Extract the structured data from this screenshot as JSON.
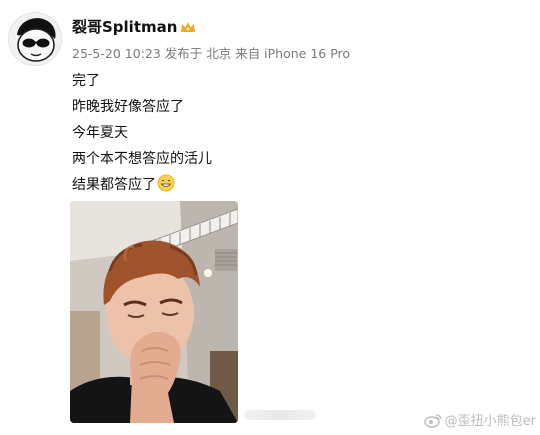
{
  "header": {
    "username": "裂哥Splitman",
    "meta": "25-5-20 10:23  发布于 北京  来自 iPhone 16 Pro"
  },
  "post": {
    "lines": [
      "完了",
      "昨晚我好像答应了",
      "今年夏天",
      "两个本不想答应的活儿",
      "结果都答应了"
    ]
  },
  "watermark": {
    "text": "@歪扭小熊包er"
  },
  "icons": {
    "avatar": "cartoon-face-with-sunglasses",
    "vip_badge": "crown-icon",
    "emoji": "grin-emoji",
    "watermark_logo": "weibo-icon"
  },
  "colors": {
    "meta": "#7a7a7a",
    "vip_badge": "#f5a623"
  }
}
